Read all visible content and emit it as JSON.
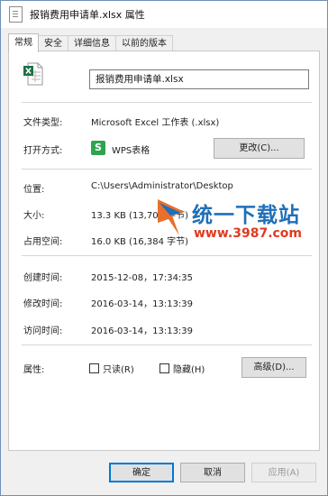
{
  "window": {
    "title": "报销费用申请单.xlsx 属性"
  },
  "tabs": [
    {
      "label": "常规",
      "active": true
    },
    {
      "label": "安全",
      "active": false
    },
    {
      "label": "详细信息",
      "active": false
    },
    {
      "label": "以前的版本",
      "active": false
    }
  ],
  "general": {
    "filename": "报销费用申请单.xlsx",
    "file_type_label": "文件类型:",
    "file_type_value": "Microsoft Excel 工作表 (.xlsx)",
    "open_with_label": "打开方式:",
    "open_with_icon_letter": "S",
    "open_with_value": "WPS表格",
    "change_button": "更改(C)...",
    "location_label": "位置:",
    "location_value": "C:\\Users\\Administrator\\Desktop",
    "size_label": "大小:",
    "size_value": "13.3 KB (13,702 字节)",
    "size_on_disk_label": "占用空间:",
    "size_on_disk_value": "16.0 KB (16,384 字节)",
    "created_label": "创建时间:",
    "created_value": "2015-12-08，17:34:35",
    "modified_label": "修改时间:",
    "modified_value": "2016-03-14，13:13:39",
    "accessed_label": "访问时间:",
    "accessed_value": "2016-03-14，13:13:39",
    "attributes_label": "属性:",
    "readonly_label": "只读(R)",
    "hidden_label": "隐藏(H)",
    "advanced_button": "高级(D)..."
  },
  "footer": {
    "ok": "确定",
    "cancel": "取消",
    "apply": "应用(A)"
  },
  "watermark": {
    "brand": "统一下载站",
    "url": "www.3987.com"
  },
  "colors": {
    "accent_border": "#6f8fb7",
    "excel_green": "#1e7145",
    "wps_green": "#2fa34f",
    "watermark_blue": "#1f6fb8",
    "watermark_red": "#e03a22"
  }
}
